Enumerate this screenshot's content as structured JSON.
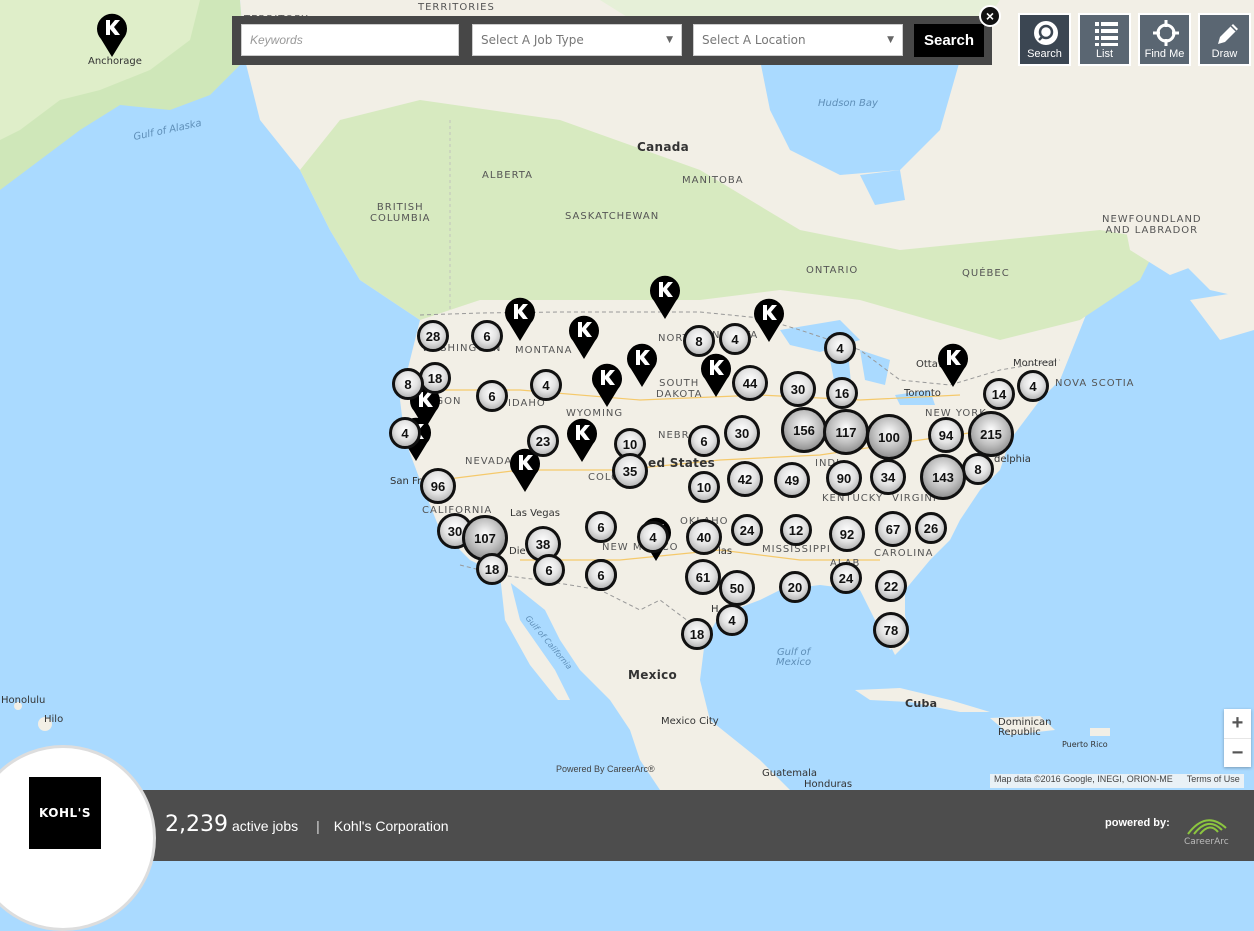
{
  "search": {
    "keywords_placeholder": "Keywords",
    "job_type": "Select A Job Type",
    "location": "Select A Location",
    "search_label": "Search",
    "close_label": "×"
  },
  "tools": [
    {
      "label": "Search",
      "icon": "search-icon"
    },
    {
      "label": "List",
      "icon": "list-icon"
    },
    {
      "label": "Find Me",
      "icon": "crosshair-icon"
    },
    {
      "label": "Draw",
      "icon": "pencil-icon"
    }
  ],
  "map": {
    "labels": {
      "canada": "Canada",
      "mexico": "Mexico",
      "united_states": "ed States",
      "cuba": "Cuba",
      "dominican_republic": "Dominican\nRepublic",
      "puerto_rico": "Puerto Rico",
      "guatemala": "Guatemala",
      "honduras": "Honduras",
      "alberta": "ALBERTA",
      "manitoba": "MANITOBA",
      "saskatchewan": "SASKATCHEWAN",
      "british_columbia": "BRITISH\nCOLUMBIA",
      "ontario": "ONTARIO",
      "quebec": "QUÉBEC",
      "newfoundland": "NEWFOUNDLAND\nAND LABRADOR",
      "nova_scotia": "NOVA SCOTIA",
      "territories": "TERRITORIES",
      "territory": "TERRITORY",
      "hudson_bay": "Hudson Bay",
      "gulf_alaska": "Gulf of Alaska",
      "gulf_mexico": "Gulf of\nMexico",
      "gulf_california": "Gulf of California",
      "montana": "MONTANA",
      "wyoming": "WYOMING",
      "nevada": "NEVADA",
      "california": "CALIFORNIA",
      "idaho": "IDAHO",
      "oregon": "EGON",
      "washington": "WASHINGTON",
      "south_dakota": "SOUTH\nDAKOTA",
      "north_dakota": "NORTH",
      "minnesota": "NESOTA",
      "nebraska": "NEBRA",
      "colorado": "COLOR",
      "oklahoma": "OKLAHO",
      "new_mexico": "NEW MEXICO",
      "mississippi": "MISSISSIPPI",
      "alabama": "ALAB",
      "kentucky": "KENTUCKY",
      "virginia": "VIRGINI",
      "carolina": "CAROLINA",
      "new_york": "NEW YORK",
      "indiana": "INDI",
      "anchorage": "Anchorage",
      "montreal": "Montreal",
      "ottawa": "Ottawa",
      "toronto": "Toronto",
      "las_vegas": "Las Vegas",
      "san_fran": "San Fr",
      "san_diego": "Die",
      "philadelphia": "delphia",
      "mexico_city": "Mexico City",
      "houston": "H",
      "dallas": "las",
      "honolulu": "Honolulu",
      "hilo": "Hilo"
    },
    "clusters": [
      "28",
      "6",
      "18",
      "8",
      "6",
      "4",
      "6",
      "4",
      "4",
      "44",
      "30",
      "16",
      "4",
      "14",
      "4",
      "4",
      "23",
      "10",
      "6",
      "30",
      "156",
      "117",
      "100",
      "94",
      "215",
      "8",
      "96",
      "35",
      "10",
      "42",
      "49",
      "90",
      "34",
      "143",
      "30",
      "107",
      "38",
      "6",
      "4",
      "40",
      "24",
      "12",
      "92",
      "67",
      "26",
      "18",
      "8",
      "6",
      "61",
      "50",
      "20",
      "24",
      "22",
      "4",
      "18",
      "78"
    ],
    "powered_map": "Powered By CareerArc®",
    "attribution": "Map data ©2016 Google, INEGI, ORION-ME",
    "terms": "Terms of Use"
  },
  "zoom": {
    "in": "+",
    "out": "−"
  },
  "footer": {
    "logo": "KOHL'S",
    "count": "2,239",
    "count_label": "active jobs",
    "separator": "|",
    "company": "Kohl's Corporation",
    "powered_by": "powered by:",
    "careerarc": "CareerArc"
  },
  "colors": {
    "land": "#f1efe8",
    "water": "#aadaff",
    "green": "#cde6b4",
    "bar": "#474747",
    "footer": "#4d4d4d",
    "pin": "#000000"
  }
}
